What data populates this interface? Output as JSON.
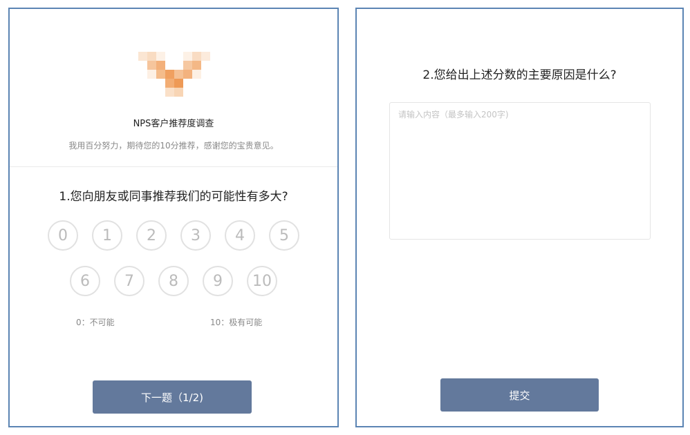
{
  "left_panel": {
    "survey_title": "NPS客户推荐度调查",
    "survey_subtitle": "我用百分努力，期待您的10分推荐，感谢您的宝贵意见。",
    "question_1": "1.您向朋友或同事推荐我们的可能性有多大?",
    "scores_row_1": [
      "0",
      "1",
      "2",
      "3",
      "4",
      "5"
    ],
    "scores_row_2": [
      "6",
      "7",
      "8",
      "9",
      "10"
    ],
    "scale_low_label": "0：不可能",
    "scale_high_label": "10：极有可能",
    "next_button_label": "下一题（1/2)"
  },
  "right_panel": {
    "question_2": "2.您给出上述分数的主要原因是什么?",
    "answer_placeholder": "请输入内容（最多输入200字)",
    "submit_button_label": "提交"
  },
  "colors": {
    "panel_border": "#5b84b3",
    "button_bg": "#63799c",
    "logo_orange": "#f0a060"
  }
}
